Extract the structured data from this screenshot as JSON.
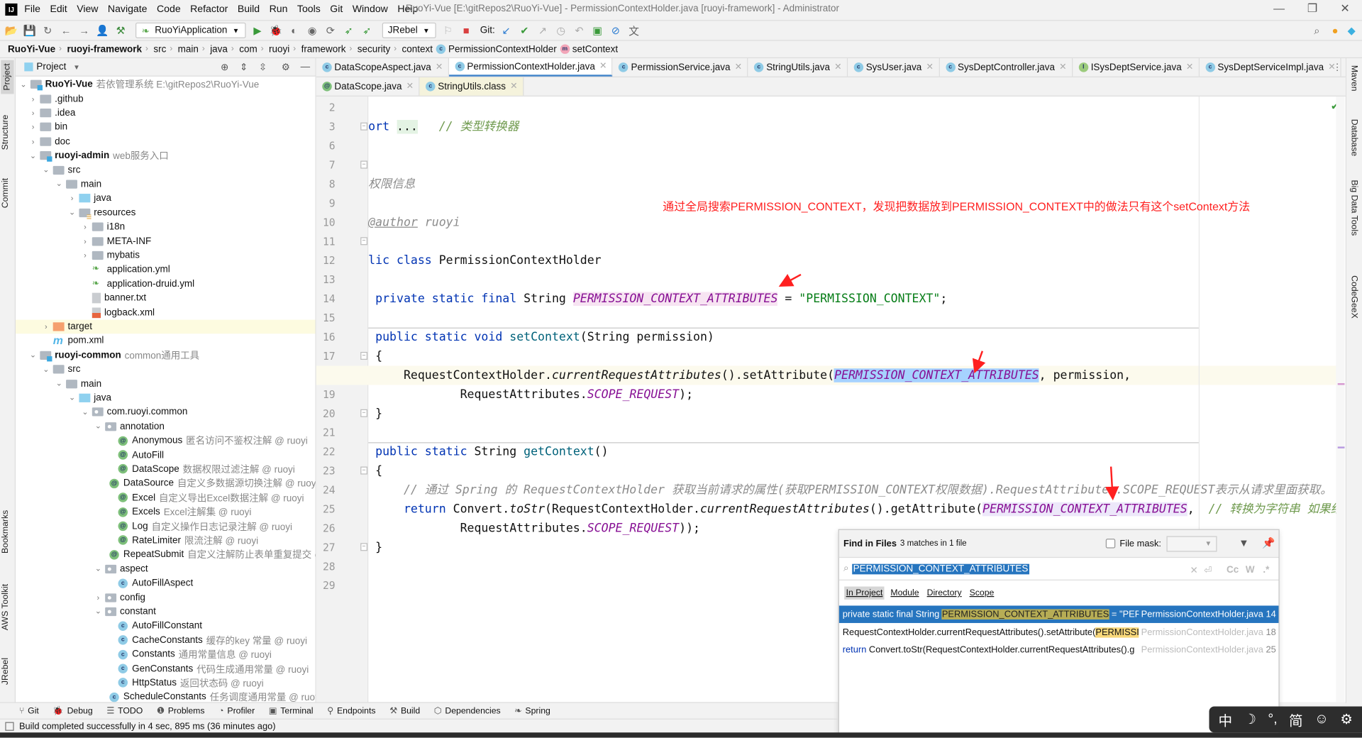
{
  "window": {
    "title": "RuoYi-Vue [E:\\gitRepos2\\RuoYi-Vue] - PermissionContextHolder.java [ruoyi-framework] - Administrator",
    "logo": "IJ"
  },
  "menu": [
    "File",
    "Edit",
    "View",
    "Navigate",
    "Code",
    "Refactor",
    "Build",
    "Run",
    "Tools",
    "Git",
    "Window",
    "Help"
  ],
  "toolbar": {
    "run_config": "RuoYiApplication",
    "jrebel": "JRebel",
    "git_label": "Git:"
  },
  "breadcrumb": [
    "RuoYi-Vue",
    "ruoyi-framework",
    "src",
    "main",
    "java",
    "com",
    "ruoyi",
    "framework",
    "security",
    "context",
    "PermissionContextHolder",
    "setContext"
  ],
  "left_strip": [
    "Project",
    "Structure",
    "Commit",
    "Bookmarks",
    "AWS Toolkit",
    "JRebel"
  ],
  "right_strip": [
    "Maven",
    "Database",
    "Big Data Tools",
    "CodeGeeX"
  ],
  "project": {
    "title": "Project",
    "tree": [
      {
        "l": 0,
        "ch": "open",
        "ic": "module",
        "name": "RuoYi-Vue",
        "bold": true,
        "hint": "若依管理系统  E:\\gitRepos2\\RuoYi-Vue"
      },
      {
        "l": 1,
        "ch": "closed",
        "ic": "folder",
        "name": ".github"
      },
      {
        "l": 1,
        "ch": "closed",
        "ic": "folder",
        "name": ".idea"
      },
      {
        "l": 1,
        "ch": "closed",
        "ic": "folder",
        "name": "bin"
      },
      {
        "l": 1,
        "ch": "closed",
        "ic": "folder",
        "name": "doc"
      },
      {
        "l": 1,
        "ch": "open",
        "ic": "module",
        "name": "ruoyi-admin",
        "bold": true,
        "hint": "web服务入口"
      },
      {
        "l": 2,
        "ch": "open",
        "ic": "folder",
        "name": "src"
      },
      {
        "l": 3,
        "ch": "open",
        "ic": "folder",
        "name": "main"
      },
      {
        "l": 4,
        "ch": "closed",
        "ic": "src",
        "name": "java"
      },
      {
        "l": 4,
        "ch": "open",
        "ic": "res",
        "name": "resources"
      },
      {
        "l": 5,
        "ch": "closed",
        "ic": "folder",
        "name": "i18n"
      },
      {
        "l": 5,
        "ch": "closed",
        "ic": "folder",
        "name": "META-INF"
      },
      {
        "l": 5,
        "ch": "closed",
        "ic": "folder",
        "name": "mybatis"
      },
      {
        "l": 5,
        "ch": "none",
        "ic": "yml",
        "name": "application.yml"
      },
      {
        "l": 5,
        "ch": "none",
        "ic": "yml",
        "name": "application-druid.yml"
      },
      {
        "l": 5,
        "ch": "none",
        "ic": "txt",
        "name": "banner.txt"
      },
      {
        "l": 5,
        "ch": "none",
        "ic": "xml",
        "name": "logback.xml"
      },
      {
        "l": 2,
        "ch": "closed",
        "ic": "orange",
        "name": "target",
        "hl": true
      },
      {
        "l": 2,
        "ch": "none",
        "ic": "mvn",
        "name": "pom.xml"
      },
      {
        "l": 1,
        "ch": "open",
        "ic": "module",
        "name": "ruoyi-common",
        "bold": true,
        "hint": "common通用工具"
      },
      {
        "l": 2,
        "ch": "open",
        "ic": "folder",
        "name": "src"
      },
      {
        "l": 3,
        "ch": "open",
        "ic": "folder",
        "name": "main"
      },
      {
        "l": 4,
        "ch": "open",
        "ic": "src",
        "name": "java"
      },
      {
        "l": 5,
        "ch": "open",
        "ic": "pkg",
        "name": "com.ruoyi.common"
      },
      {
        "l": 6,
        "ch": "open",
        "ic": "pkg",
        "name": "annotation"
      },
      {
        "l": 7,
        "ch": "none",
        "ic": "anno",
        "name": "Anonymous",
        "hint": "匿名访问不鉴权注解 @ ruoyi"
      },
      {
        "l": 7,
        "ch": "none",
        "ic": "anno",
        "name": "AutoFill"
      },
      {
        "l": 7,
        "ch": "none",
        "ic": "anno",
        "name": "DataScope",
        "hint": "数据权限过滤注解 @ ruoyi"
      },
      {
        "l": 7,
        "ch": "none",
        "ic": "anno",
        "name": "DataSource",
        "hint": "自定义多数据源切换注解 @ ruoyi"
      },
      {
        "l": 7,
        "ch": "none",
        "ic": "anno",
        "name": "Excel",
        "hint": "自定义导出Excel数据注解 @ ruoyi"
      },
      {
        "l": 7,
        "ch": "none",
        "ic": "anno",
        "name": "Excels",
        "hint": "Excel注解集 @ ruoyi"
      },
      {
        "l": 7,
        "ch": "none",
        "ic": "anno",
        "name": "Log",
        "hint": "自定义操作日志记录注解 @ ruoyi"
      },
      {
        "l": 7,
        "ch": "none",
        "ic": "anno",
        "name": "RateLimiter",
        "hint": "限流注解 @ ruoyi"
      },
      {
        "l": 7,
        "ch": "none",
        "ic": "anno",
        "name": "RepeatSubmit",
        "hint": "自定义注解防止表单重复提交 @ ruoyi"
      },
      {
        "l": 6,
        "ch": "open",
        "ic": "pkg",
        "name": "aspect"
      },
      {
        "l": 7,
        "ch": "none",
        "ic": "class",
        "name": "AutoFillAspect"
      },
      {
        "l": 6,
        "ch": "closed",
        "ic": "pkg",
        "name": "config"
      },
      {
        "l": 6,
        "ch": "open",
        "ic": "pkg",
        "name": "constant"
      },
      {
        "l": 7,
        "ch": "none",
        "ic": "class",
        "name": "AutoFillConstant"
      },
      {
        "l": 7,
        "ch": "none",
        "ic": "class",
        "name": "CacheConstants",
        "hint": "缓存的key 常量 @ ruoyi"
      },
      {
        "l": 7,
        "ch": "none",
        "ic": "class",
        "name": "Constants",
        "hint": "通用常量信息 @ ruoyi"
      },
      {
        "l": 7,
        "ch": "none",
        "ic": "class",
        "name": "GenConstants",
        "hint": "代码生成通用常量 @ ruoyi"
      },
      {
        "l": 7,
        "ch": "none",
        "ic": "class",
        "name": "HttpStatus",
        "hint": "返回状态码 @ ruoyi"
      },
      {
        "l": 7,
        "ch": "none",
        "ic": "class",
        "name": "ScheduleConstants",
        "hint": "任务调度通用常量 @ ruoyi"
      }
    ]
  },
  "tabs_row1": [
    {
      "name": "DataScopeAspect.java",
      "icon": "c"
    },
    {
      "name": "PermissionContextHolder.java",
      "icon": "c",
      "active": true
    },
    {
      "name": "PermissionService.java",
      "icon": "c"
    },
    {
      "name": "StringUtils.java",
      "icon": "c"
    },
    {
      "name": "SysUser.java",
      "icon": "c"
    },
    {
      "name": "SysDeptController.java",
      "icon": "c"
    },
    {
      "name": "ISysDeptService.java",
      "icon": "i"
    },
    {
      "name": "SysDeptServiceImpl.java",
      "icon": "c"
    }
  ],
  "tabs_row2": [
    {
      "name": "DataScope.java",
      "icon": "a"
    },
    {
      "name": "StringUtils.class",
      "icon": "c",
      "active": true
    }
  ],
  "code": [
    {
      "n": 2,
      "t": []
    },
    {
      "n": 3,
      "fold": true,
      "t": [
        {
          "s": "ort ",
          "c": "kw"
        },
        {
          "s": "...",
          "c": "foldbg"
        },
        {
          "s": "   // 类型转换器",
          "c": "cmtg"
        }
      ]
    },
    {
      "n": 6,
      "t": []
    },
    {
      "n": 7,
      "fold": true,
      "t": []
    },
    {
      "n": 8,
      "t": [
        {
          "s": "权限信息",
          "c": "doc"
        }
      ]
    },
    {
      "n": 9,
      "t": []
    },
    {
      "n": 10,
      "t": [
        {
          "s": "@author",
          "c": "doctag"
        },
        {
          "s": " ruoyi",
          "c": "doc"
        }
      ]
    },
    {
      "n": 11,
      "fold": true,
      "t": []
    },
    {
      "n": 12,
      "t": [
        {
          "s": "lic class ",
          "c": "kw"
        },
        {
          "s": "PermissionContextHolder",
          "c": ""
        }
      ]
    },
    {
      "n": 13,
      "t": []
    },
    {
      "n": 14,
      "t": [
        {
          "s": " private static final ",
          "c": "kw"
        },
        {
          "s": "String ",
          "c": ""
        },
        {
          "s": "PERMISSION_CONTEXT_ATTRIBUTES",
          "c": "const pinkbg"
        },
        {
          "s": " = ",
          "c": ""
        },
        {
          "s": "\"PERMISSION_CONTEXT\"",
          "c": "str"
        },
        {
          "s": ";",
          "c": ""
        }
      ]
    },
    {
      "n": 15,
      "t": []
    },
    {
      "n": 16,
      "t": [
        {
          "s": " public static void ",
          "c": "kw"
        },
        {
          "s": "setContext",
          "c": "method"
        },
        {
          "s": "(String permission)",
          "c": ""
        }
      ]
    },
    {
      "n": 17,
      "fold": true,
      "t": [
        {
          "s": " {",
          "c": ""
        }
      ]
    },
    {
      "n": 18,
      "current": true,
      "t": [
        {
          "s": "     RequestContextHolder.",
          "c": ""
        },
        {
          "s": "currentRequestAttributes",
          "c": "it"
        },
        {
          "s": "().setAttribute(",
          "c": ""
        },
        {
          "s": "PERMISSION_CONTEXT_ATTRIBUTES",
          "c": "const bluebg"
        },
        {
          "s": ", permission,",
          "c": ""
        }
      ]
    },
    {
      "n": 19,
      "t": [
        {
          "s": "             RequestAttributes.",
          "c": ""
        },
        {
          "s": "SCOPE_REQUEST",
          "c": "const"
        },
        {
          "s": ");",
          "c": ""
        }
      ]
    },
    {
      "n": 20,
      "fold": true,
      "t": [
        {
          "s": " }",
          "c": ""
        }
      ]
    },
    {
      "n": 21,
      "t": []
    },
    {
      "n": 22,
      "t": [
        {
          "s": " public static ",
          "c": "kw"
        },
        {
          "s": "String ",
          "c": ""
        },
        {
          "s": "getContext",
          "c": "method"
        },
        {
          "s": "()",
          "c": ""
        }
      ]
    },
    {
      "n": 23,
      "fold": true,
      "t": [
        {
          "s": " {",
          "c": ""
        }
      ]
    },
    {
      "n": 24,
      "t": [
        {
          "s": "     // 通过 Spring 的 RequestContextHolder 获取当前请求的属性(获取PERMISSION_CONTEXT权限数据).RequestAttributes.SCOPE_REQUEST表示从请求里面获取。",
          "c": "cmt"
        }
      ]
    },
    {
      "n": 25,
      "t": [
        {
          "s": "     ",
          "c": ""
        },
        {
          "s": "return ",
          "c": "kw"
        },
        {
          "s": "Convert.",
          "c": ""
        },
        {
          "s": "toStr",
          "c": "it"
        },
        {
          "s": "(RequestContextHolder.",
          "c": ""
        },
        {
          "s": "currentRequestAttributes",
          "c": "it"
        },
        {
          "s": "().getAttribute(",
          "c": ""
        },
        {
          "s": "PERMISSION_CONTEXT_ATTRIBUTES",
          "c": "const lavbg"
        },
        {
          "s": ",  ",
          "c": ""
        },
        {
          "s": "// 转换为字符串 如果结",
          "c": "cmtg"
        }
      ]
    },
    {
      "n": 26,
      "t": [
        {
          "s": "             RequestAttributes.",
          "c": ""
        },
        {
          "s": "SCOPE_REQUEST",
          "c": "const"
        },
        {
          "s": "));",
          "c": ""
        }
      ]
    },
    {
      "n": 27,
      "fold": true,
      "t": [
        {
          "s": " }",
          "c": ""
        }
      ]
    },
    {
      "n": 28,
      "t": []
    },
    {
      "n": 29,
      "t": []
    }
  ],
  "annotation": "通过全局搜索PERMISSION_CONTEXT，发现把数据放到PERMISSION_CONTEXT中的做法只有这个setContext方法",
  "find": {
    "title": "Find in Files",
    "summary": "3 matches in 1 file",
    "file_mask_label": "File mask:",
    "file_mask_checked": false,
    "query": "PERMISSION_CONTEXT_ATTRIBUTES",
    "options": [
      "Cc",
      "W",
      ".*"
    ],
    "scopes": [
      {
        "label": "In Project",
        "selected": true
      },
      {
        "label": "Module"
      },
      {
        "label": "Directory"
      },
      {
        "label": "Scope"
      }
    ],
    "results": [
      {
        "pre_kw": "",
        "pre": "private static final String ",
        "match": "PERMISSION_CONTEXT_ATTRIBUTES",
        "post": " = \"PERMI",
        "file": "PermissionContextHolder.java",
        "line": "14",
        "selected": true
      },
      {
        "pre_kw": "",
        "pre": "RequestContextHolder.currentRequestAttributes().setAttribute(",
        "match": "PERMISSI",
        "post": "",
        "file": "PermissionContextHolder.java",
        "line": "18"
      },
      {
        "pre_kw": "return",
        "pre": " Convert.toStr(RequestContextHolder.currentRequestAttributes().g",
        "match": "",
        "post": "",
        "file": "PermissionContextHolder.java",
        "line": "25"
      }
    ]
  },
  "bottom_tabs": [
    "Git",
    "Debug",
    "TODO",
    "Problems",
    "Profiler",
    "Terminal",
    "Endpoints",
    "Build",
    "Dependencies",
    "Spring"
  ],
  "status": "Build completed successfully in 4 sec, 895 ms (36 minutes ago)",
  "ime": [
    "中",
    "☽",
    "°,",
    "简",
    "☺",
    "⚙"
  ],
  "colors": {
    "keyword": "#0033b3",
    "string": "#067d17",
    "constant": "#871094",
    "selection": "#2675bf",
    "annotation": "#ff2020"
  }
}
